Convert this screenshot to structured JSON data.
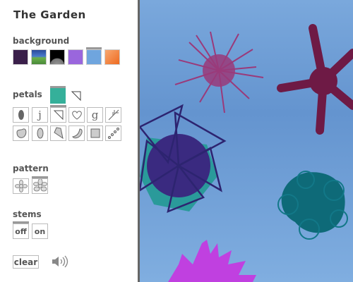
{
  "app": {
    "title": "The Garden"
  },
  "background": {
    "label": "background",
    "swatches": [
      {
        "name": "dark-purple",
        "color": "#3a1f4a"
      },
      {
        "name": "sky-grass",
        "color": "#4a8a3a"
      },
      {
        "name": "moon",
        "color": "#222222"
      },
      {
        "name": "purple-watercolor",
        "color": "#9a66dd"
      },
      {
        "name": "blue-watercolor",
        "color": "#6fa5de",
        "selected": true
      },
      {
        "name": "orange-watercolor",
        "color": "#f08a40"
      }
    ]
  },
  "petals": {
    "label": "petals",
    "color": "#35b09a",
    "shapes": [
      "oval",
      "j",
      "triangle",
      "heart",
      "g",
      "branch",
      "blob",
      "ellipse",
      "kite",
      "crescent",
      "square",
      "dots"
    ],
    "selected": "triangle"
  },
  "pattern": {
    "label": "pattern",
    "options": [
      "flower-small",
      "flower-large"
    ],
    "selected": "flower-large"
  },
  "stems": {
    "label": "stems",
    "off": "off",
    "on": "on",
    "selected": "off"
  },
  "actions": {
    "clear": "clear"
  },
  "colors": {
    "canvas": "#6f9fd6",
    "divider": "#666666"
  }
}
